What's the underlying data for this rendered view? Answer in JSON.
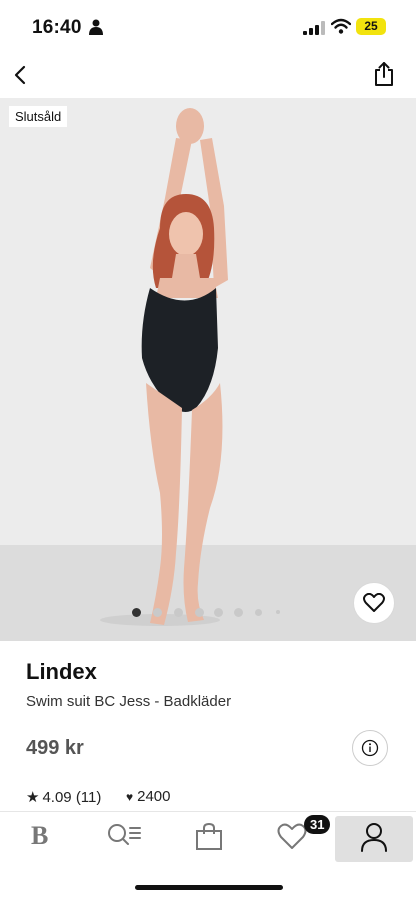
{
  "status_bar": {
    "time": "16:40",
    "battery": "25"
  },
  "product": {
    "badge": "Slutsåld",
    "brand": "Lindex",
    "name": "Swim suit BC Jess - Badkläder",
    "price": "499 kr",
    "rating": "4.09 (11)",
    "likes": "2400"
  },
  "gallery": {
    "image_count": 8,
    "active_index": 0
  },
  "tab_bar": {
    "tabs": [
      "home-logo",
      "search",
      "shopping-bag",
      "favorites",
      "profile"
    ],
    "home_logo": "B",
    "favorites_count": "31",
    "active": "profile"
  },
  "colors": {
    "badge_bg": "#111111",
    "battery": "#f2e30e",
    "active_tab_bg": "#e0e0e0"
  }
}
